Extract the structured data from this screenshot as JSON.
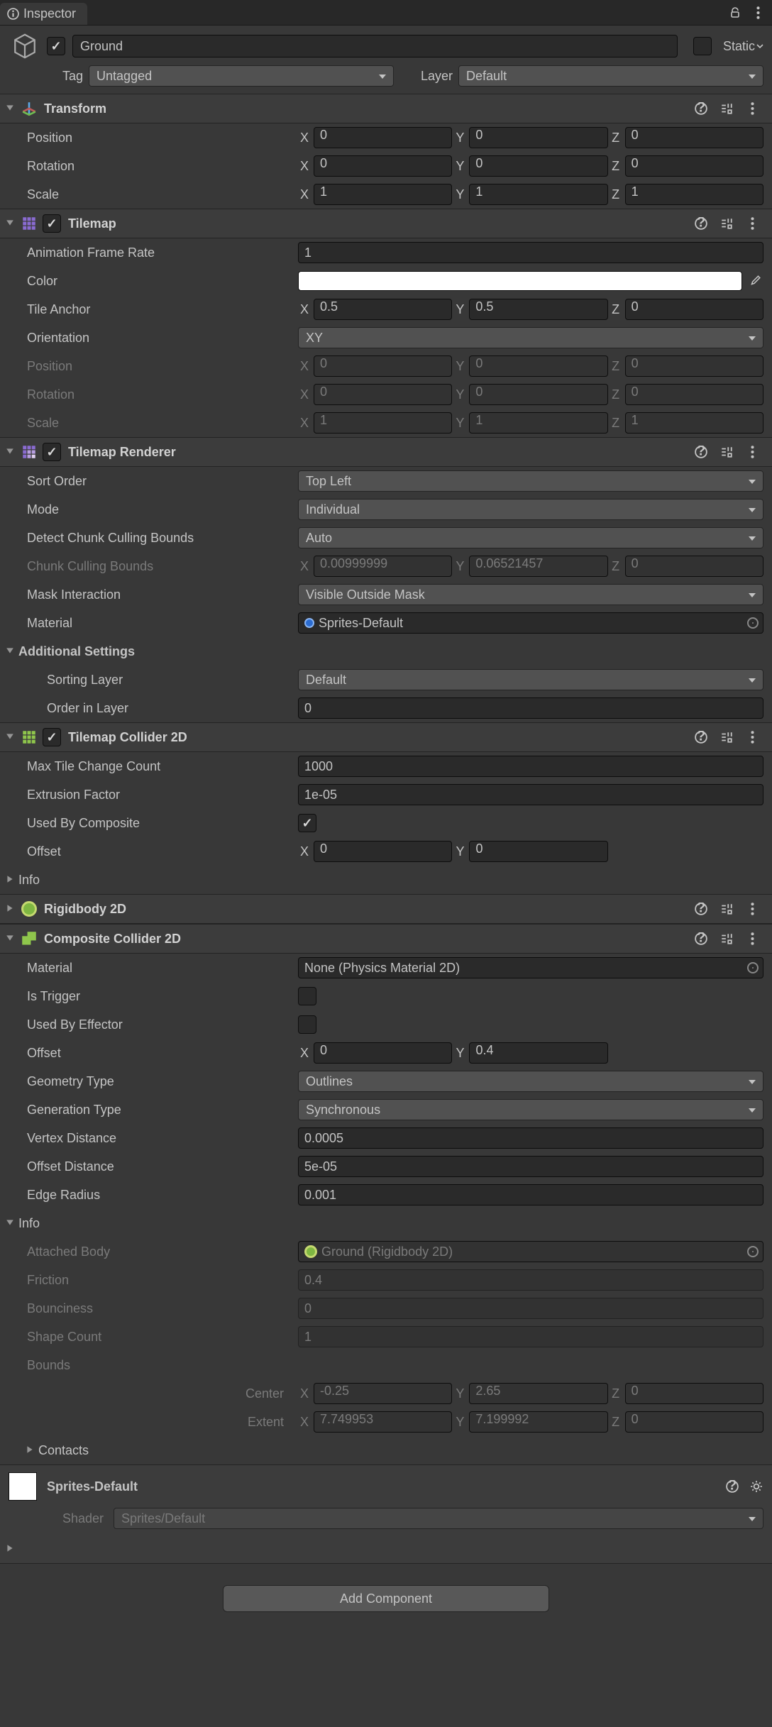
{
  "tab": {
    "title": "Inspector"
  },
  "object": {
    "name": "Ground",
    "active": true,
    "static_label": "Static",
    "tag_label": "Tag",
    "tag_value": "Untagged",
    "layer_label": "Layer",
    "layer_value": "Default"
  },
  "transform": {
    "title": "Transform",
    "position_label": "Position",
    "position": {
      "x": "0",
      "y": "0",
      "z": "0"
    },
    "rotation_label": "Rotation",
    "rotation": {
      "x": "0",
      "y": "0",
      "z": "0"
    },
    "scale_label": "Scale",
    "scale": {
      "x": "1",
      "y": "1",
      "z": "1"
    }
  },
  "tilemap": {
    "title": "Tilemap",
    "enabled": true,
    "anim_rate_label": "Animation Frame Rate",
    "anim_rate": "1",
    "color_label": "Color",
    "anchor_label": "Tile Anchor",
    "anchor": {
      "x": "0.5",
      "y": "0.5",
      "z": "0"
    },
    "orientation_label": "Orientation",
    "orientation": "XY",
    "position_label": "Position",
    "position": {
      "x": "0",
      "y": "0",
      "z": "0"
    },
    "rotation_label": "Rotation",
    "rotation": {
      "x": "0",
      "y": "0",
      "z": "0"
    },
    "scale_label": "Scale",
    "scale": {
      "x": "1",
      "y": "1",
      "z": "1"
    }
  },
  "renderer": {
    "title": "Tilemap Renderer",
    "enabled": true,
    "sort_order_label": "Sort Order",
    "sort_order": "Top Left",
    "mode_label": "Mode",
    "mode": "Individual",
    "detect_label": "Detect Chunk Culling Bounds",
    "detect": "Auto",
    "chunk_label": "Chunk Culling Bounds",
    "chunk": {
      "x": "0.00999999",
      "y": "0.06521457",
      "z": "0"
    },
    "mask_label": "Mask Interaction",
    "mask": "Visible Outside Mask",
    "material_label": "Material",
    "material": "Sprites-Default",
    "additional_label": "Additional Settings",
    "sorting_layer_label": "Sorting Layer",
    "sorting_layer": "Default",
    "order_label": "Order in Layer",
    "order": "0"
  },
  "collider": {
    "title": "Tilemap Collider 2D",
    "enabled": true,
    "max_tile_label": "Max Tile Change Count",
    "max_tile": "1000",
    "extrusion_label": "Extrusion Factor",
    "extrusion": "1e-05",
    "used_composite_label": "Used By Composite",
    "used_composite": true,
    "offset_label": "Offset",
    "offset": {
      "x": "0",
      "y": "0"
    },
    "info_label": "Info"
  },
  "rigidbody": {
    "title": "Rigidbody 2D"
  },
  "composite": {
    "title": "Composite Collider 2D",
    "material_label": "Material",
    "material": "None (Physics Material 2D)",
    "trigger_label": "Is Trigger",
    "effector_label": "Used By Effector",
    "offset_label": "Offset",
    "offset": {
      "x": "0",
      "y": "0.4"
    },
    "geometry_label": "Geometry Type",
    "geometry": "Outlines",
    "generation_label": "Generation Type",
    "generation": "Synchronous",
    "vertex_label": "Vertex Distance",
    "vertex": "0.0005",
    "offset_dist_label": "Offset Distance",
    "offset_dist": "5e-05",
    "edge_label": "Edge Radius",
    "edge": "0.001",
    "info_label": "Info",
    "attached_label": "Attached Body",
    "attached": "Ground (Rigidbody 2D)",
    "friction_label": "Friction",
    "friction": "0.4",
    "bounciness_label": "Bounciness",
    "bounciness": "0",
    "shape_label": "Shape Count",
    "shape": "1",
    "bounds_label": "Bounds",
    "center_label": "Center",
    "center": {
      "x": "-0.25",
      "y": "2.65",
      "z": "0"
    },
    "extent_label": "Extent",
    "extent": {
      "x": "7.749953",
      "y": "7.199992",
      "z": "0"
    },
    "contacts_label": "Contacts"
  },
  "material_section": {
    "title": "Sprites-Default",
    "shader_label": "Shader",
    "shader": "Sprites/Default"
  },
  "add_component": "Add Component"
}
